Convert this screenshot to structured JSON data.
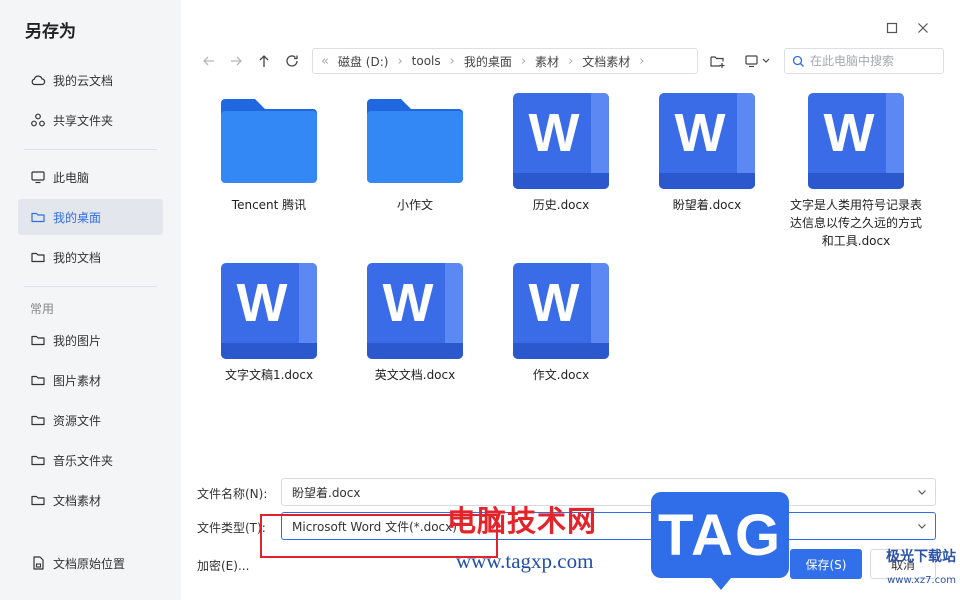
{
  "dialog": {
    "title": "另存为"
  },
  "sidebar": {
    "top_items": [
      {
        "label": "我的云文档",
        "icon": "cloud-icon"
      },
      {
        "label": "共享文件夹",
        "icon": "share-icon"
      }
    ],
    "location_items": [
      {
        "label": "此电脑",
        "icon": "monitor-icon"
      },
      {
        "label": "我的桌面",
        "icon": "folder-icon",
        "active": true
      },
      {
        "label": "我的文档",
        "icon": "folder-icon"
      }
    ],
    "section_title": "常用",
    "common_items": [
      {
        "label": "我的图片",
        "icon": "folder-icon"
      },
      {
        "label": "图片素材",
        "icon": "folder-icon"
      },
      {
        "label": "资源文件",
        "icon": "folder-icon"
      },
      {
        "label": "音乐文件夹",
        "icon": "folder-icon"
      },
      {
        "label": "文档素材",
        "icon": "folder-icon"
      }
    ],
    "bottom_item": {
      "label": "文档原始位置",
      "icon": "document-location-icon"
    }
  },
  "toolbar": {
    "breadcrumb": [
      "磁盘 (D:)",
      "tools",
      "我的桌面",
      "素材",
      "文档素材"
    ],
    "search_placeholder": "在此电脑中搜索"
  },
  "files": [
    {
      "name": "Tencent 腾讯",
      "type": "folder"
    },
    {
      "name": "小作文",
      "type": "folder"
    },
    {
      "name": "历史.docx",
      "type": "word"
    },
    {
      "name": "盼望着.docx",
      "type": "word"
    },
    {
      "name": "文字是人类用符号记录表达信息以传之久远的方式和工具.docx",
      "type": "word"
    },
    {
      "name": "文字文稿1.docx",
      "type": "word"
    },
    {
      "name": "英文文档.docx",
      "type": "word"
    },
    {
      "name": "作文.docx",
      "type": "word"
    }
  ],
  "word_icon_letter": "W",
  "form": {
    "filename_label": "文件名称(N):",
    "filename_value": "盼望着.docx",
    "filetype_label": "文件类型(T):",
    "filetype_value": "Microsoft Word 文件(*.docx)",
    "encrypt_label": "加密(E)...",
    "save_label": "保存(S)",
    "cancel_label": "取消"
  },
  "watermark": {
    "cn_text": "电脑技术网",
    "url": "www.tagxp.com",
    "tag": "TAG",
    "xz_text": "极光下载站",
    "xz_url": "www.xz7.com"
  },
  "colors": {
    "accent": "#2f6ee8",
    "word_blue": "#3a6ce8",
    "folder_blue": "#2b7cf2",
    "watermark_red": "#e3242b"
  }
}
